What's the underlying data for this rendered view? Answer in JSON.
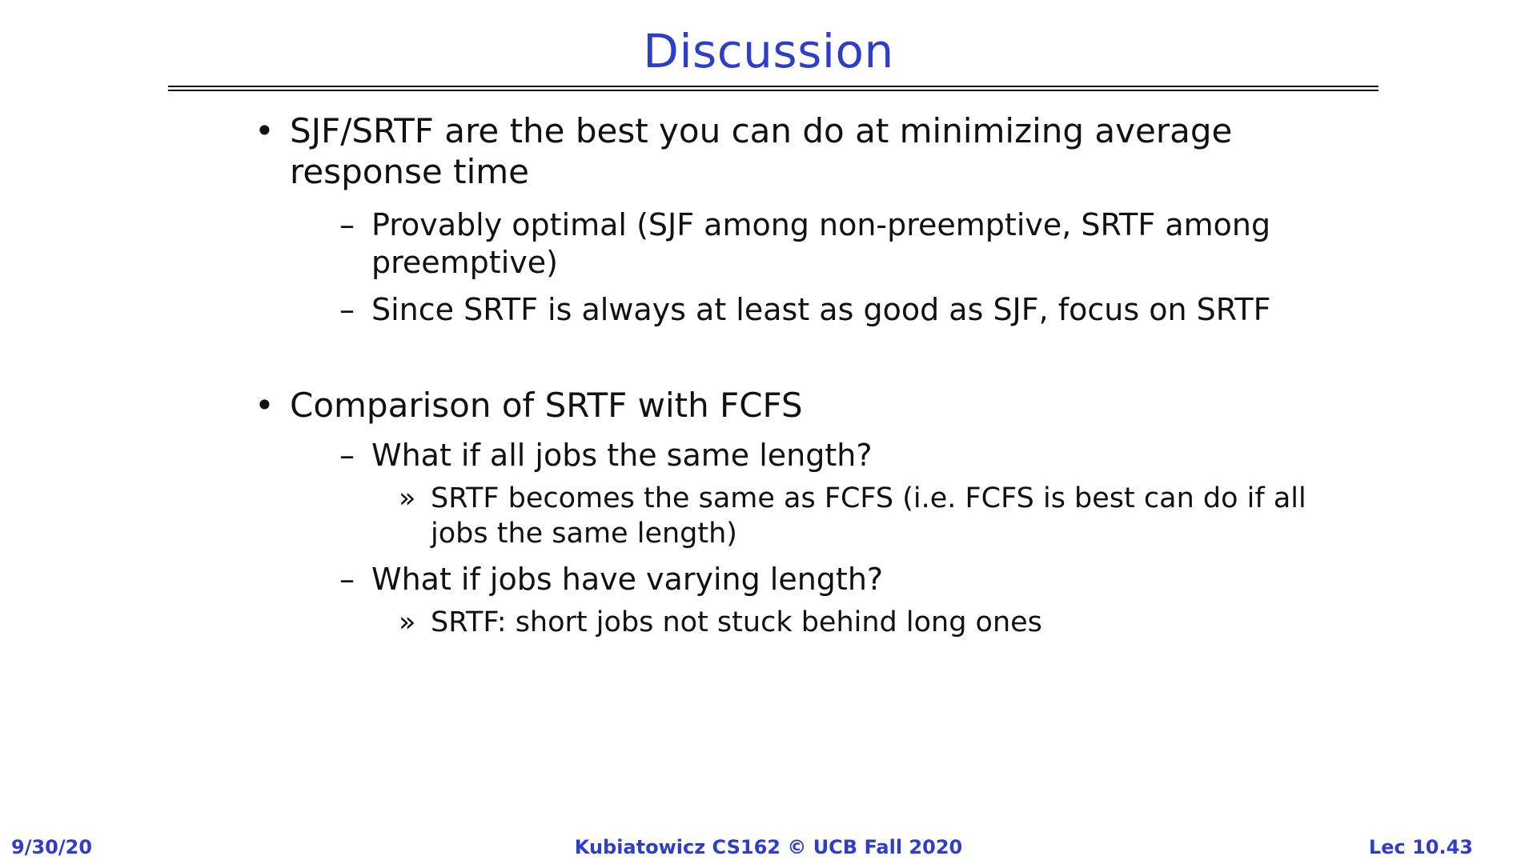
{
  "title": "Discussion",
  "bullets": [
    {
      "text": "SJF/SRTF are the best you can do at minimizing average response time",
      "marker": "•",
      "children": [
        {
          "text": "Provably optimal (SJF among non-preemptive, SRTF among preemptive)",
          "marker": "–"
        },
        {
          "text": "Since SRTF is always at least as good as SJF, focus on SRTF",
          "marker": "–"
        }
      ]
    },
    {
      "text": "Comparison of SRTF with FCFS",
      "marker": "•",
      "children": [
        {
          "text": "What if all jobs the same length?",
          "marker": "–",
          "children": [
            {
              "text": "SRTF becomes the same as FCFS (i.e. FCFS is best can do if all jobs the same length)",
              "marker": "»"
            }
          ]
        },
        {
          "text": "What if jobs have varying length?",
          "marker": "–",
          "children": [
            {
              "text": "SRTF: short jobs not stuck behind long ones",
              "marker": "»"
            }
          ]
        }
      ]
    }
  ],
  "footer": {
    "date": "9/30/20",
    "course": "Kubiatowicz CS162 © UCB Fall 2020",
    "lecture": "Lec 10.43"
  },
  "colors": {
    "accent": "#2f3ec9",
    "text": "#111111"
  }
}
